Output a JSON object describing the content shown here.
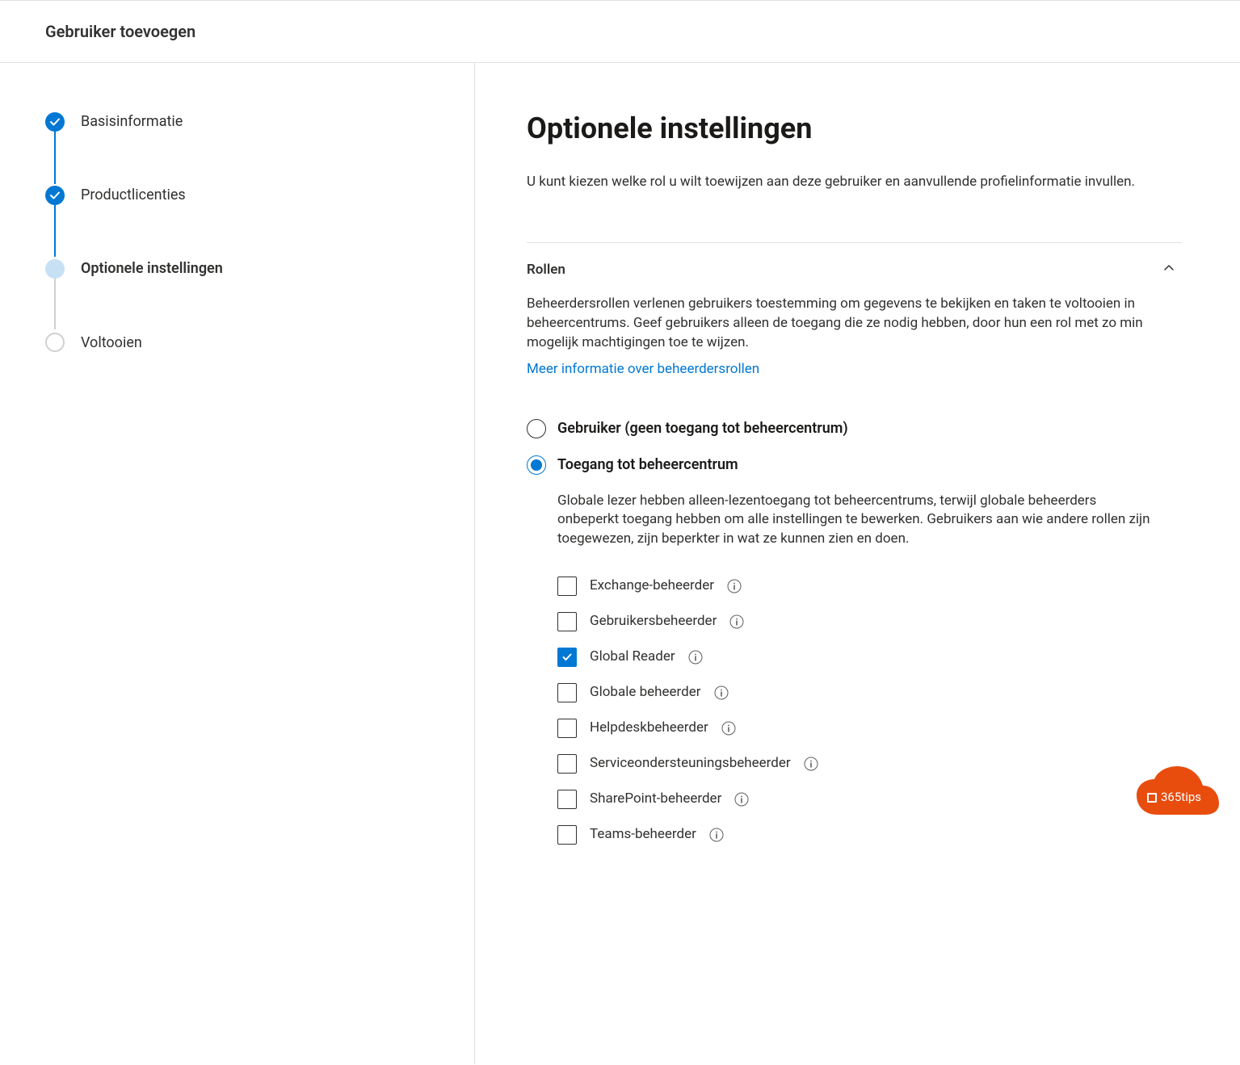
{
  "header": {
    "title": "Gebruiker toevoegen"
  },
  "sidebar": {
    "steps": [
      {
        "label": "Basisinformatie",
        "state": "done"
      },
      {
        "label": "Productlicenties",
        "state": "done"
      },
      {
        "label": "Optionele instellingen",
        "state": "current"
      },
      {
        "label": "Voltooien",
        "state": "pending"
      }
    ]
  },
  "main": {
    "title": "Optionele instellingen",
    "description": "U kunt kiezen welke rol u wilt toewijzen aan deze gebruiker en aanvullende profielinformatie invullen.",
    "section": {
      "title": "Rollen",
      "description": "Beheerdersrollen verlenen gebruikers toestemming om gegevens te bekijken en taken te voltooien in beheercentrums. Geef gebruikers alleen de toegang die ze nodig hebben, door hun een rol met zo min mogelijk machtigingen toe te wijzen.",
      "link": "Meer informatie over beheerdersrollen",
      "radios": [
        {
          "label": "Gebruiker (geen toegang tot beheercentrum)",
          "selected": false
        },
        {
          "label": "Toegang tot beheercentrum",
          "selected": true
        }
      ],
      "radioDescription": "Globale lezer hebben alleen-lezentoegang tot beheercentrums, terwijl globale beheerders onbeperkt toegang hebben om alle instellingen te bewerken. Gebruikers aan wie andere rollen zijn toegewezen, zijn beperkter in wat ze kunnen zien en doen.",
      "roles": [
        {
          "label": "Exchange-beheerder",
          "checked": false
        },
        {
          "label": "Gebruikersbeheerder",
          "checked": false
        },
        {
          "label": "Global Reader",
          "checked": true
        },
        {
          "label": "Globale beheerder",
          "checked": false
        },
        {
          "label": "Helpdeskbeheerder",
          "checked": false
        },
        {
          "label": "Serviceondersteuningsbeheerder",
          "checked": false
        },
        {
          "label": "SharePoint-beheerder",
          "checked": false
        },
        {
          "label": "Teams-beheerder",
          "checked": false
        }
      ]
    }
  },
  "badge": {
    "text": "365tips"
  }
}
